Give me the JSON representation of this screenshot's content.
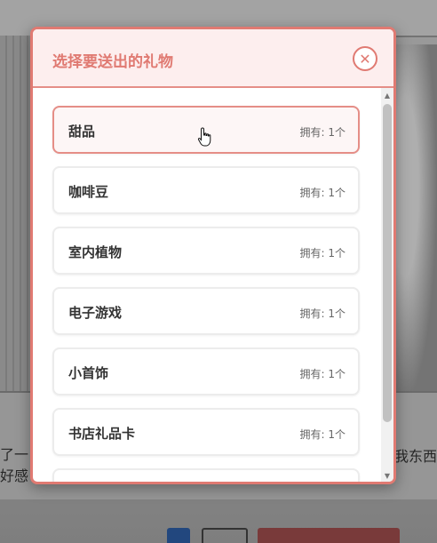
{
  "background": {
    "dialog_text_left": "了一目\n好感",
    "dialog_text_right": "我东西"
  },
  "modal": {
    "title": "选择要送出的礼物",
    "close_icon": "close-icon",
    "owned_prefix": "拥有:",
    "items": [
      {
        "name": "甜品",
        "owned": "拥有: 1个"
      },
      {
        "name": "咖啡豆",
        "owned": "拥有: 1个"
      },
      {
        "name": "室内植物",
        "owned": "拥有: 1个"
      },
      {
        "name": "电子游戏",
        "owned": "拥有: 1个"
      },
      {
        "name": "小首饰",
        "owned": "拥有: 1个"
      },
      {
        "name": "书店礼品卡",
        "owned": "拥有: 1个"
      }
    ]
  },
  "colors": {
    "accent": "#e07a72",
    "header_bg": "#fdeeee"
  }
}
